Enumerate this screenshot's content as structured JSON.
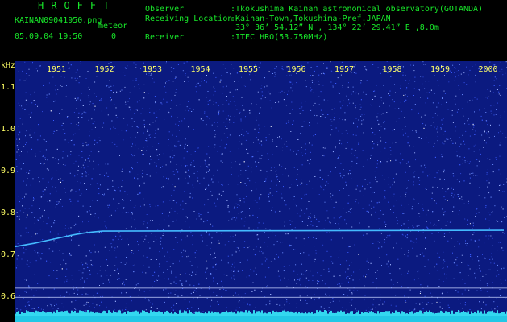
{
  "header": {
    "logo": "HROFFT",
    "filename": "KAINAN09041950.png",
    "datetime": "05.09.04 19:50",
    "meteor_label": "meteor",
    "meteor_count": "0",
    "observer_label": "Observer",
    "observer_value": ":Tkokushima Kainan astronomical observatory(GOTANDA)",
    "location_label": "Receiving Location",
    "location_value": ":Kainan-Town,Tokushima-Pref.JAPAN",
    "coords_value": "33° 36’ 54.12” N , 134° 22’ 29.41” E ,8.0m",
    "receiver_label": "Receiver",
    "receiver_value": ":ITEC HRO(53.750MHz)"
  },
  "colors": {
    "background": "#000000",
    "spectrum": "#0b1a80",
    "header_text": "#18e82a",
    "axis_text": "#ffff66",
    "trace": "#44bbff"
  },
  "chart_data": {
    "type": "line",
    "ylabel": "kHz",
    "x_ticks": [
      "1951",
      "1952",
      "1953",
      "1954",
      "1955",
      "1956",
      "1957",
      "1958",
      "1959",
      "2000"
    ],
    "y_ticks": [
      "1.1",
      "1.0",
      "0.9",
      "0.8",
      "0.7",
      "0.6"
    ],
    "ylim": [
      0.56,
      1.16
    ],
    "xlim": [
      1950,
      2000
    ],
    "series": [
      {
        "x": [
          1950,
          1952,
          1954,
          1956,
          1957,
          1958,
          1959,
          2000
        ],
        "values": [
          0.717,
          0.725,
          0.735,
          0.745,
          0.749,
          0.752,
          0.754,
          0.756
        ]
      }
    ],
    "reference_lines": [
      0.618,
      0.596
    ]
  }
}
